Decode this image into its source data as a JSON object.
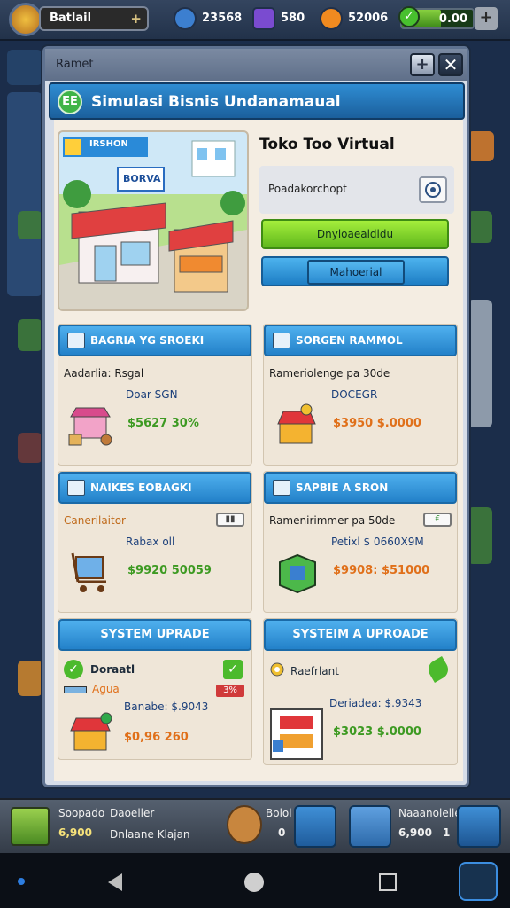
{
  "hud": {
    "player_name": "Batlail",
    "gems": "23568",
    "tickets": "580",
    "coins": "52006",
    "money": "0.00",
    "money_fill": 0.55
  },
  "modal": {
    "breadcrumb": "Ramet",
    "title": "Simulasi Bisnis Undanamaual",
    "title_icon": "EE"
  },
  "hero": {
    "banner": "IRSHON",
    "shop_sign": "BORVA",
    "heading": "Toko Too Virtual",
    "sub_label": "Poadakorchopt",
    "green_button": "Dnyloaealdldu",
    "blue_button": "Mahoerial"
  },
  "cards": [
    {
      "title": "BAGRIA YG SROEKI",
      "line1": "Aadarlia: Rsgal",
      "line2": "Doar SGN",
      "price": "$5627 30%",
      "price_color": "green"
    },
    {
      "title": "SORGEN RAMMOL",
      "line1": "Rameriolenge pa 30de",
      "line2": "DOCEGR",
      "price": "$3950 $.0000",
      "price_color": "orange"
    },
    {
      "title": "NAIKES EOBAGKI",
      "line1": "Canerilaitor",
      "line2": "Rabax oll",
      "price": "$9920 50059",
      "price_color": "green"
    },
    {
      "title": "SAPBIE A SRON",
      "line1": "Ramenirimmer pa 50de",
      "line2": "Petixl $ 0660X9M",
      "price": "$9908: $51000",
      "price_color": "orange"
    },
    {
      "title": "SYSTEM UPRADE",
      "line1": "Doraatl",
      "line1b": "Agua",
      "line2": "Banabe: $.9043",
      "price": "$0,96 260",
      "price_color": "orange",
      "badge": "3%"
    },
    {
      "title": "SYSTEIM A UPROADE",
      "line1": "Raefrlant",
      "line2": "Deriadea: $.9343",
      "price": "$3023 $.0000",
      "price_color": "green"
    }
  ],
  "bottom": {
    "left_title": "Soopado",
    "left_value": "6,900",
    "middle_label": "Daoeller",
    "middle_sub": "Dnlaane Klajan",
    "counter_left": "0",
    "right_label": "Bolol",
    "right_title": "Naaanoleiles",
    "right_value": "6,900",
    "right_count": "1"
  }
}
